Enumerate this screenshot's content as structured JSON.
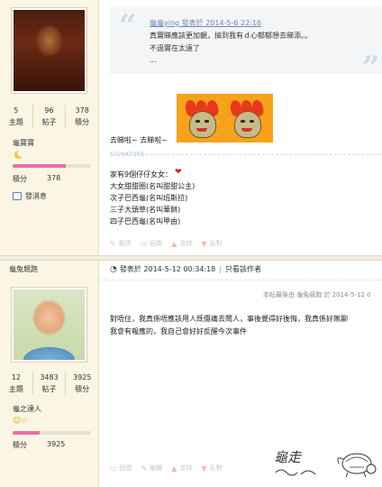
{
  "post1": {
    "user": {
      "name": "龜寶寶",
      "stats": [
        {
          "value": "5",
          "label": "主題"
        },
        {
          "value": "96",
          "label": "帖子"
        },
        {
          "value": "378",
          "label": "積分"
        }
      ],
      "level_progress": 0.68,
      "points_label": "積分",
      "points_value": "378",
      "message_label": "發消息",
      "accent_color": "#ec6fa6"
    },
    "quote": {
      "header": "龜龜ying 發表於 2014-5-6 22:16",
      "lines": [
        "真實睇應該更加靚，搞到我有ｄ心郁郁想去睇添。。",
        "不過實在太遠了",
        "..."
      ]
    },
    "body_text": "去睇啦~ 去睇啦~",
    "signature_label": "SIGNATURE",
    "signature_lines": [
      "家有9個仔仔女女：",
      "大女甜甜圈(名叫甜甜公主)",
      "次子巴西龜(名叫班斯拉)",
      "三子大頭草(名叫華餅)",
      "四子巴西龜(名叫甲由)"
    ],
    "actions": [
      "點評",
      "回復",
      "支持",
      "反對"
    ]
  },
  "post2": {
    "user": {
      "name": "龜兔競跑",
      "stats": [
        {
          "value": "12",
          "label": "主題"
        },
        {
          "value": "3483",
          "label": "帖子"
        },
        {
          "value": "3925",
          "label": "積分"
        }
      ],
      "title": "龜之達人",
      "level_progress": 0.35,
      "points_label": "積分",
      "points_value": "3925"
    },
    "meta": {
      "posted": "發表於 2014-5-12 00:34:18",
      "separator": "|",
      "author_only": "只看該作者"
    },
    "edited_note": "本帖最後由 龜兔競跑 於 2014-5-12 0",
    "body_lines": [
      "對唔住，我真係唔應該用人既傷痛去鬧人，事後覺得好後悔，我真係好無聊",
      "我會有報應的，我自己會好好反醒今次事件"
    ],
    "actions": [
      "回復",
      "編輯",
      "支持",
      "反對"
    ],
    "signature_art_text": "龜走"
  }
}
